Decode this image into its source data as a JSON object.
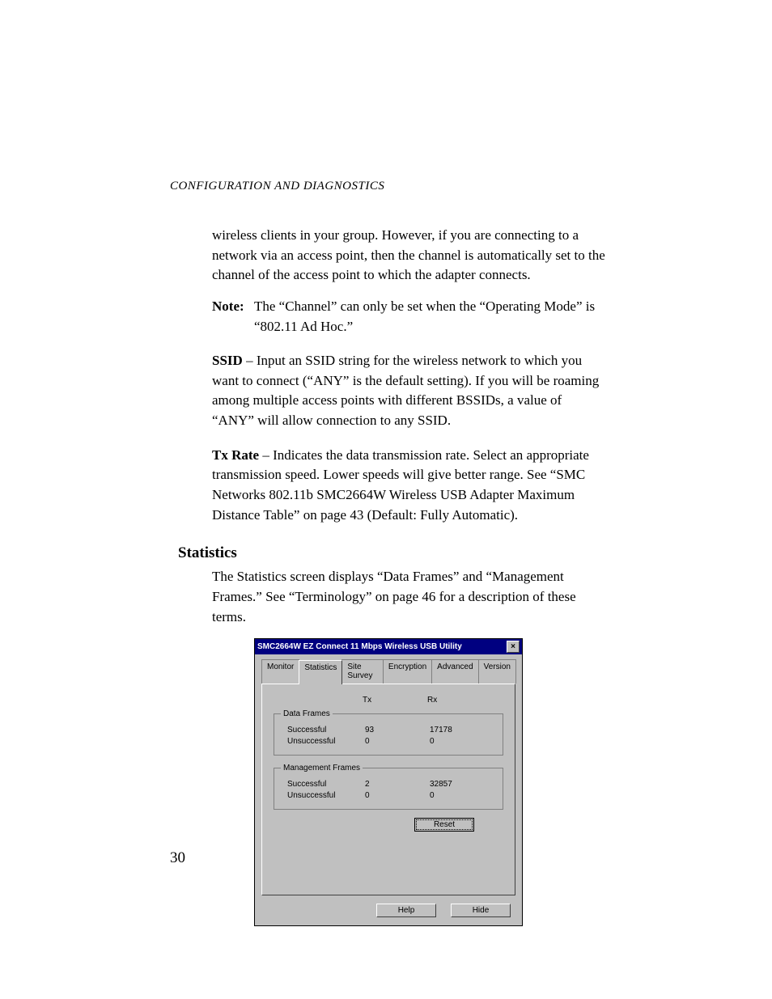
{
  "running_head": "CONFIGURATION AND DIAGNOSTICS",
  "page_number": "30",
  "para_intro": "wireless clients in your group. However, if you are connecting to a network via an access point, then the channel is automatically set to the channel of the access point to which the adapter connects.",
  "note_label": "Note:",
  "note_text": "The “Channel” can only be set when the “Operating Mode” is “802.11 Ad Hoc.”",
  "ssid_term": "SSID",
  "ssid_body": " – Input an SSID string for the wireless network to which you want to connect (“ANY” is the default setting). If you will be roaming among multiple access points with different BSSIDs, a value of “ANY” will allow connection to any SSID.",
  "txrate_term": "Tx Rate",
  "txrate_body": " – Indicates the data transmission rate. Select an appropriate transmission speed. Lower speeds will give better range. See “SMC Networks 802.11b SMC2664W Wireless USB Adapter Maximum Distance Table” on page 43 (Default: Fully Automatic).",
  "stats_heading": "Statistics",
  "stats_intro": "The Statistics screen displays “Data Frames” and “Management Frames.” See “Terminology” on page 46 for a description of these terms.",
  "dialog": {
    "title": "SMC2664W EZ Connect 11 Mbps Wireless USB Utility",
    "close_x": "×",
    "tabs": [
      "Monitor",
      "Statistics",
      "Site Survey",
      "Encryption",
      "Advanced",
      "Version"
    ],
    "active_tab": "Statistics",
    "col_tx": "Tx",
    "col_rx": "Rx",
    "groups": [
      {
        "legend": "Data Frames",
        "rows": [
          {
            "label": "Successful",
            "tx": "93",
            "rx": "17178"
          },
          {
            "label": "Unsuccessful",
            "tx": "0",
            "rx": "0"
          }
        ]
      },
      {
        "legend": "Management Frames",
        "rows": [
          {
            "label": "Successful",
            "tx": "2",
            "rx": "32857"
          },
          {
            "label": "Unsuccessful",
            "tx": "0",
            "rx": "0"
          }
        ]
      }
    ],
    "reset": "Reset",
    "help": "Help",
    "hide": "Hide"
  },
  "chart_data": {
    "type": "table",
    "title": "Wireless USB Utility Statistics",
    "columns": [
      "Group",
      "Metric",
      "Tx",
      "Rx"
    ],
    "rows": [
      [
        "Data Frames",
        "Successful",
        93,
        17178
      ],
      [
        "Data Frames",
        "Unsuccessful",
        0,
        0
      ],
      [
        "Management Frames",
        "Successful",
        2,
        32857
      ],
      [
        "Management Frames",
        "Unsuccessful",
        0,
        0
      ]
    ]
  }
}
